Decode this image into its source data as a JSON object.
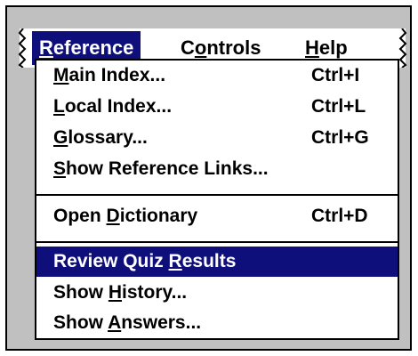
{
  "menubar": {
    "items": [
      {
        "before": "",
        "mnemonic": "R",
        "after": "eference"
      },
      {
        "before": "C",
        "mnemonic": "o",
        "after": "ntrols"
      },
      {
        "before": "",
        "mnemonic": "H",
        "after": "elp"
      }
    ]
  },
  "menu": {
    "items": [
      {
        "before": "",
        "mnemonic": "M",
        "after": "ain Index...",
        "shortcut": "Ctrl+I"
      },
      {
        "before": "",
        "mnemonic": "L",
        "after": "ocal Index...",
        "shortcut": "Ctrl+L"
      },
      {
        "before": "",
        "mnemonic": "G",
        "after": "lossary...",
        "shortcut": "Ctrl+G"
      },
      {
        "before": "",
        "mnemonic": "S",
        "after": "how Reference Links...",
        "shortcut": ""
      },
      {
        "before": "Open ",
        "mnemonic": "D",
        "after": "ictionary",
        "shortcut": "Ctrl+D"
      },
      {
        "before": "Review Quiz ",
        "mnemonic": "R",
        "after": "esults",
        "shortcut": ""
      },
      {
        "before": "Show ",
        "mnemonic": "H",
        "after": "istory...",
        "shortcut": ""
      },
      {
        "before": "Show ",
        "mnemonic": "A",
        "after": "nswers...",
        "shortcut": ""
      }
    ]
  },
  "colors": {
    "highlight": "#0f0f7c",
    "background": "#c0c0c0"
  }
}
